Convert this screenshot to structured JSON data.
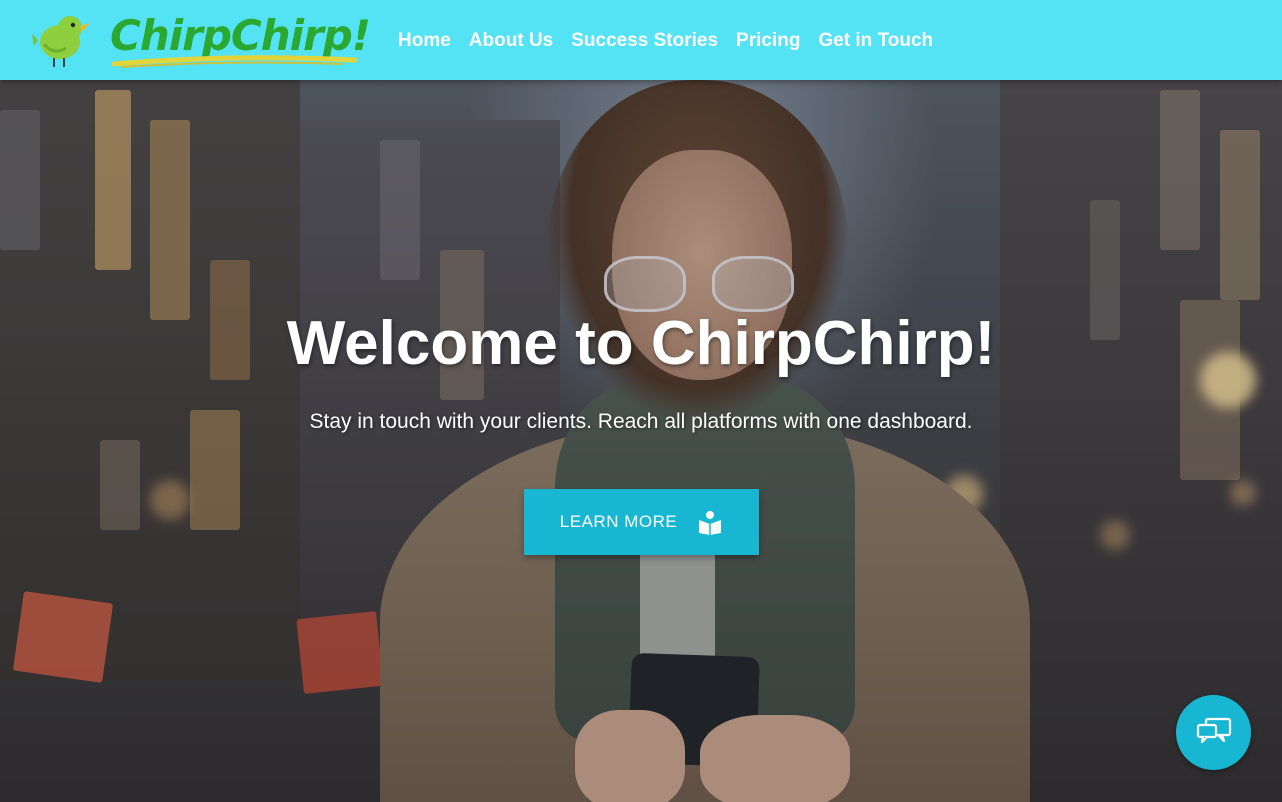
{
  "brand": {
    "name": "ChirpChirp!",
    "logo_icon": "bird-logo-icon",
    "color": "#2aa82f"
  },
  "header": {
    "background": "#53e3f5"
  },
  "nav": {
    "items": [
      {
        "label": "Home"
      },
      {
        "label": "About Us"
      },
      {
        "label": "Success Stories"
      },
      {
        "label": "Pricing"
      },
      {
        "label": "Get in Touch"
      }
    ]
  },
  "hero": {
    "title": "Welcome to ChirpChirp!",
    "subtitle": "Stay in touch with your clients. Reach all platforms with one dashboard.",
    "cta": {
      "label": "LEARN MORE",
      "icon": "book-reader-icon",
      "color": "#17b7d3"
    }
  },
  "chat_widget": {
    "icon": "chat-bubbles-icon",
    "color": "#17b7d3"
  }
}
